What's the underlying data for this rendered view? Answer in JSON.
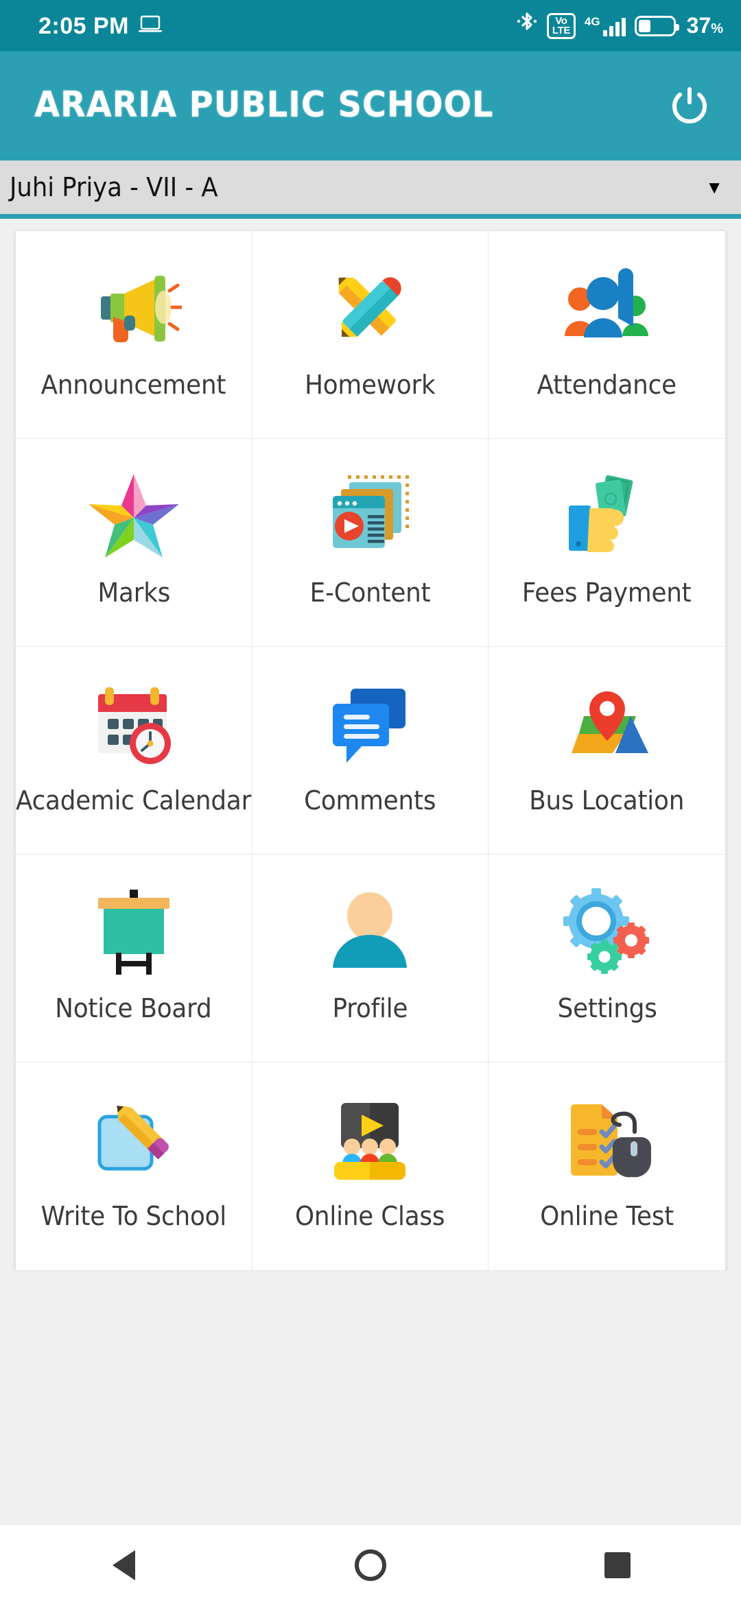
{
  "status_bar": {
    "time": "2:05 PM",
    "cast_icon": "laptop-icon",
    "bluetooth_icon": "bluetooth-icon",
    "volte_top": "Vo",
    "volte_bottom": "LTE",
    "network_type": "4G",
    "battery_percent": "37",
    "battery_percent_symbol": "%",
    "battery_level": 37
  },
  "app_bar": {
    "title": "ARARIA PUBLIC SCHOOL",
    "power_icon": "power-icon",
    "background_color": "#2ba0b3"
  },
  "student_selector": {
    "selected": "Juhi Priya - VII - A",
    "caret": "▼"
  },
  "grid": {
    "tiles": [
      {
        "label": "Announcement",
        "icon": "megaphone-icon"
      },
      {
        "label": "Homework",
        "icon": "crossed-pencils-icon"
      },
      {
        "label": "Attendance",
        "icon": "people-raised-hand-icon"
      },
      {
        "label": "Marks",
        "icon": "colorful-star-icon"
      },
      {
        "label": "E-Content",
        "icon": "media-windows-icon"
      },
      {
        "label": "Fees Payment",
        "icon": "hand-money-icon"
      },
      {
        "label": "Academic Calendar",
        "icon": "calendar-clock-icon"
      },
      {
        "label": "Comments",
        "icon": "chat-bubbles-icon"
      },
      {
        "label": "Bus Location",
        "icon": "map-pin-icon"
      },
      {
        "label": "Notice Board",
        "icon": "presentation-board-icon"
      },
      {
        "label": "Profile",
        "icon": "user-avatar-icon"
      },
      {
        "label": "Settings",
        "icon": "gears-icon"
      },
      {
        "label": "Write To School",
        "icon": "note-pencil-icon"
      },
      {
        "label": "Online Class",
        "icon": "classroom-video-icon"
      },
      {
        "label": "Online Test",
        "icon": "checklist-mouse-icon"
      }
    ]
  },
  "navigation_bar": {
    "back": "back-triangle-icon",
    "home": "home-circle-icon",
    "recents": "recents-square-icon"
  }
}
